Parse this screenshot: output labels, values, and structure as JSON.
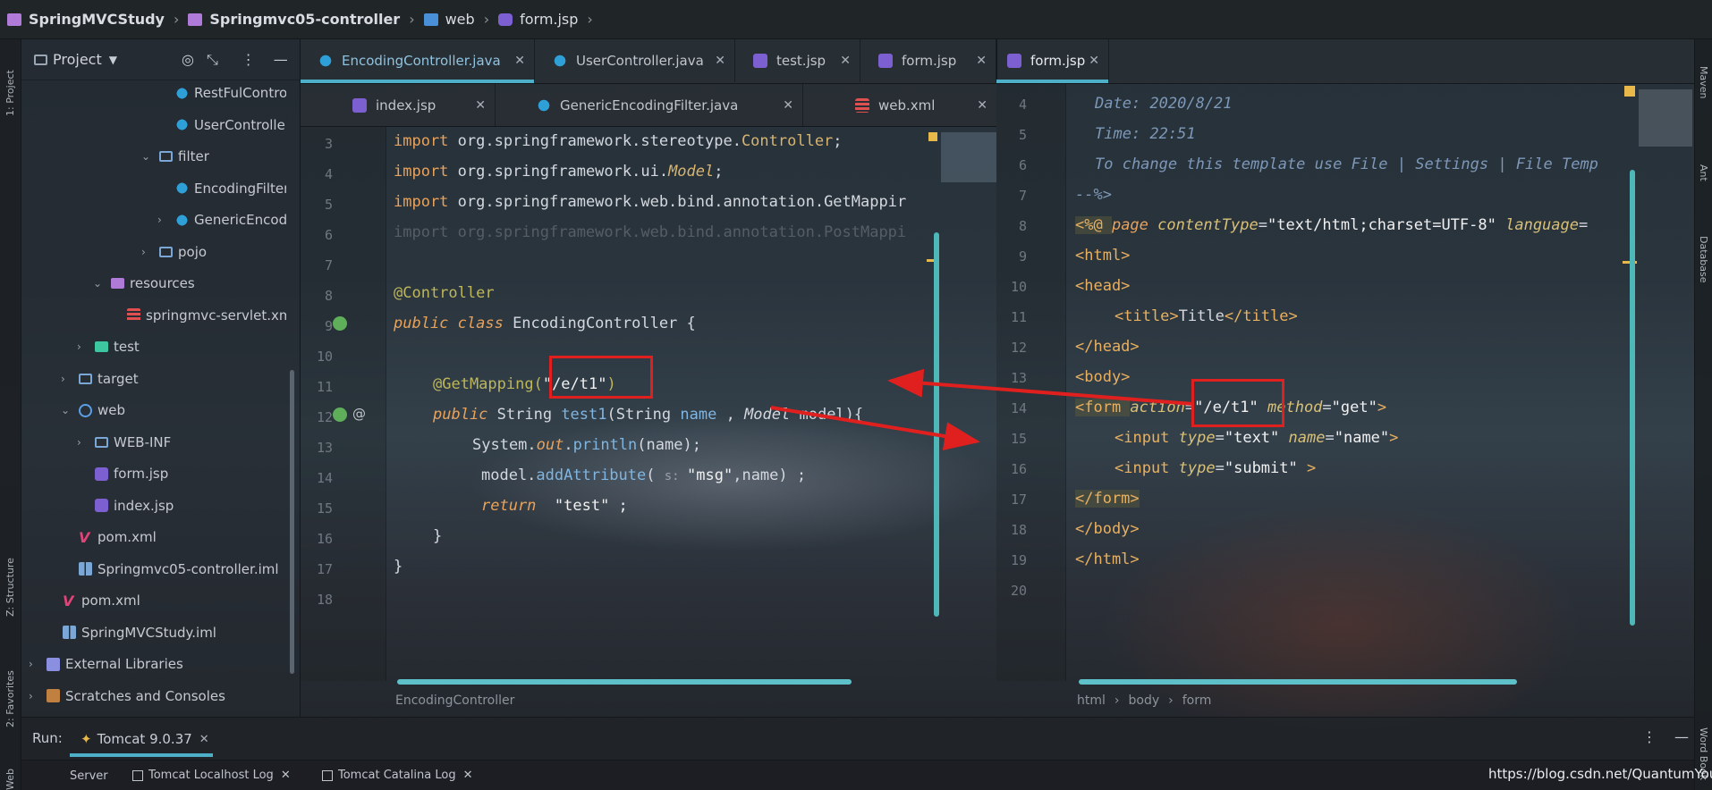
{
  "breadcrumb": [
    "SpringMVCStudy",
    "Springmvc05-controller",
    "web",
    "form.jsp"
  ],
  "left_strip": {
    "project": "1: Project",
    "structure": "Z: Structure",
    "favorites": "2: Favorites",
    "web": "Web"
  },
  "right_strip": {
    "maven": "Maven",
    "ant": "Ant",
    "database": "Database",
    "word": "Word Book"
  },
  "project_panel": {
    "title": "Project",
    "tree": [
      {
        "label": "RestFulController",
        "icon": "class-icon",
        "depth": 8
      },
      {
        "label": "UserController",
        "icon": "class-icon",
        "depth": 8
      },
      {
        "label": "filter",
        "icon": "package-icon",
        "depth": 7,
        "expanded": true
      },
      {
        "label": "EncodingFilter",
        "icon": "class-icon",
        "depth": 8
      },
      {
        "label": "GenericEncodingFilter",
        "icon": "class-icon",
        "depth": 8,
        "collapsed": true
      },
      {
        "label": "pojo",
        "icon": "folder-icon",
        "depth": 7,
        "collapsed": true
      },
      {
        "label": "resources",
        "icon": "resources-icon",
        "depth": 4,
        "expanded": true
      },
      {
        "label": "springmvc-servlet.xml",
        "icon": "xml-icon",
        "depth": 5
      },
      {
        "label": "test",
        "icon": "test-folder-icon",
        "depth": 3,
        "collapsed": true
      },
      {
        "label": "target",
        "icon": "folder-icon",
        "depth": 2,
        "collapsed": true
      },
      {
        "label": "web",
        "icon": "web-folder-icon",
        "depth": 2,
        "expanded": true
      },
      {
        "label": "WEB-INF",
        "icon": "folder-icon",
        "depth": 3,
        "collapsed": true
      },
      {
        "label": "form.jsp",
        "icon": "jsp-icon",
        "depth": 3
      },
      {
        "label": "index.jsp",
        "icon": "jsp-icon",
        "depth": 3
      },
      {
        "label": "pom.xml",
        "icon": "maven-icon",
        "depth": 2
      },
      {
        "label": "Springmvc05-controller.iml",
        "icon": "iml-icon",
        "depth": 2
      },
      {
        "label": "pom.xml",
        "icon": "maven-icon",
        "depth": 1
      },
      {
        "label": "SpringMVCStudy.iml",
        "icon": "iml-icon",
        "depth": 1
      },
      {
        "label": "External Libraries",
        "icon": "library-icon",
        "depth": 0,
        "collapsed": true
      },
      {
        "label": "Scratches and Consoles",
        "icon": "scratch-icon",
        "depth": 0,
        "collapsed": true
      }
    ]
  },
  "left_editor": {
    "tabs_row1": [
      {
        "label": "EncodingController.java",
        "active": true
      },
      {
        "label": "UserController.java"
      },
      {
        "label": "test.jsp"
      },
      {
        "label": "form.jsp"
      }
    ],
    "tabs_row2": [
      {
        "label": "index.jsp"
      },
      {
        "label": "GenericEncodingFilter.java"
      },
      {
        "label": "web.xml"
      }
    ],
    "line_numbers": [
      "3",
      "4",
      "5",
      "6",
      "7",
      "8",
      "9",
      "10",
      "11",
      "12",
      "13",
      "14",
      "15",
      "16",
      "17",
      "18"
    ],
    "lines": {
      "l3": [
        "import ",
        "org.springframework.stereotype.",
        "Controller",
        ";"
      ],
      "l4": [
        "import ",
        "org.springframework.ui.",
        "Model",
        ";"
      ],
      "l5": [
        "import ",
        "org.springframework.web.bind.annotation.",
        "GetMappir"
      ],
      "l6": [
        "import org.springframework.web.bind.annotation.PostMappi"
      ],
      "l8": [
        "@Controller"
      ],
      "l9": [
        "public class ",
        "EncodingController {"
      ],
      "l11": [
        "@GetMapping(",
        "\"/e/t1\"",
        ")"
      ],
      "l12": [
        "public ",
        "String ",
        "test1",
        "(String ",
        "name",
        " , ",
        "Model",
        " model){"
      ],
      "l13": [
        "System.",
        "out",
        ".",
        "println",
        "(name);"
      ],
      "l14": [
        "model.",
        "addAttribute",
        "( ",
        "s: ",
        "\"msg\"",
        ",name) ;"
      ],
      "l15": [
        "return ",
        " \"test\" ;"
      ],
      "l16": [
        "}"
      ],
      "l17": [
        "}"
      ]
    },
    "status": "EncodingController"
  },
  "right_editor": {
    "tab": "form.jsp",
    "line_numbers": [
      "4",
      "5",
      "6",
      "7",
      "8",
      "9",
      "10",
      "11",
      "12",
      "13",
      "14",
      "15",
      "16",
      "17",
      "18",
      "19",
      "20"
    ],
    "lines": {
      "l4": "Date: 2020/8/21",
      "l5": "Time: 22:51",
      "l6": "To change this template use File | Settings | File Temp",
      "l7": "--%>",
      "l8": [
        "<%@ ",
        "page ",
        "contentType",
        "=",
        "\"text/html;charset=UTF-8\"",
        " ",
        "language",
        "="
      ],
      "l9": "<html>",
      "l10": "<head>",
      "l11": [
        "<title>",
        "Title",
        "</title>"
      ],
      "l12": "</head>",
      "l13": "<body>",
      "l14": [
        "<form ",
        "action",
        "=",
        "\"/e/t1\"",
        " ",
        "method",
        "=",
        "\"get\"",
        ">"
      ],
      "l15": [
        "<input ",
        "type",
        "=",
        "\"text\"",
        " ",
        "name",
        "=",
        "\"name\"",
        ">"
      ],
      "l16": [
        "<input ",
        "type",
        "=",
        "\"submit\"",
        " >"
      ],
      "l17": "</form>",
      "l18": "</body>",
      "l19": "</html>"
    },
    "breadcrumb": [
      "html",
      "body",
      "form"
    ]
  },
  "run_panel": {
    "label": "Run:",
    "config": "Tomcat 9.0.37",
    "tabs": [
      "Server",
      "Tomcat Localhost Log",
      "Tomcat Catalina Log"
    ]
  },
  "watermark": "https://blog.csdn.net/QuantumYou",
  "colors": {
    "accent": "#4eb0c8",
    "highlight_box": "#e0201e",
    "arrow": "#e0201e"
  }
}
